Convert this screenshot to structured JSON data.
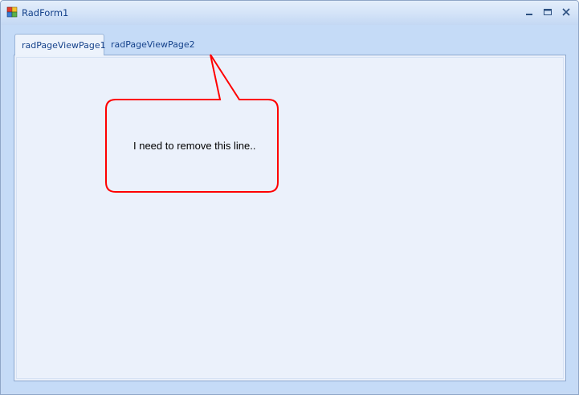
{
  "window": {
    "title": "RadForm1"
  },
  "tabs": [
    {
      "label": "radPageViewPage1",
      "selected": true
    },
    {
      "label": "radPageViewPage2",
      "selected": false
    }
  ],
  "annotation": {
    "text": "I need to remove this line..",
    "border_color": "#ff0000"
  },
  "colors": {
    "title_text": "#15428b",
    "frame": "#c6daf5",
    "content": "#ebf1fb"
  },
  "icons": {
    "app": "app-icon",
    "minimize": "minimize-icon",
    "maximize": "maximize-icon",
    "close": "close-icon"
  }
}
